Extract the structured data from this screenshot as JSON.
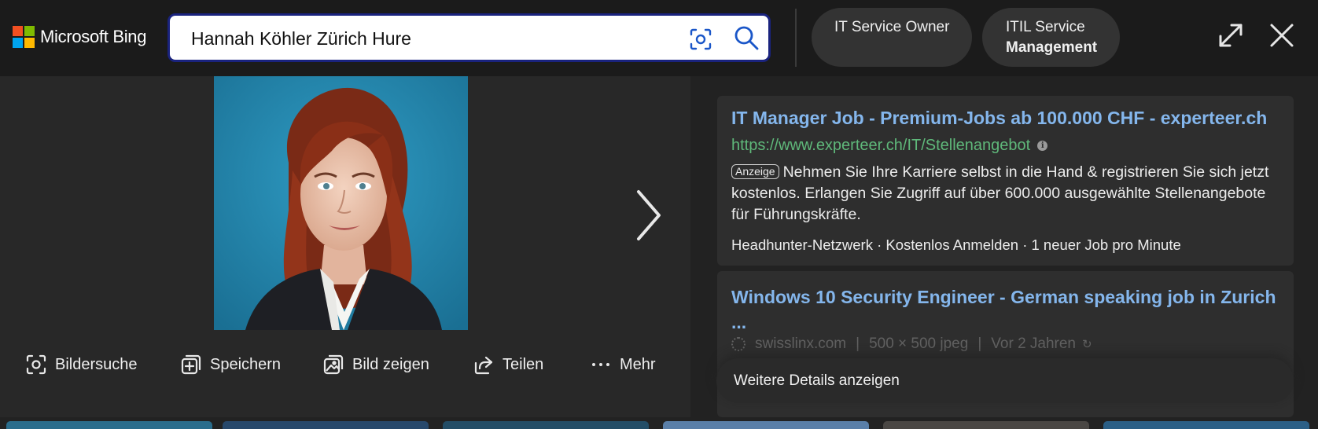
{
  "header": {
    "brand": "Microsoft Bing",
    "search_value": "Hannah Köhler Zürich Hure",
    "search_placeholder": "",
    "icons": [
      "visual-search-icon",
      "search-icon",
      "expand-icon",
      "close-icon"
    ],
    "chips": [
      {
        "label": "IT Service Owner"
      },
      {
        "label_line1": "ITIL Service",
        "label_line2": "Management"
      }
    ]
  },
  "viewer": {
    "image_alt": "Portrait of a woman with red curly hair in a dark blazer on a teal background",
    "actions": [
      {
        "label": "Bildersuche",
        "icon": "visual-search-icon"
      },
      {
        "label": "Speichern",
        "icon": "add-collection-icon"
      },
      {
        "label": "Bild zeigen",
        "icon": "view-image-icon"
      },
      {
        "label": "Teilen",
        "icon": "share-icon"
      },
      {
        "label": "Mehr",
        "icon": "more-icon"
      }
    ]
  },
  "ads": [
    {
      "title": "IT Manager Job - Premium-Jobs ab 100.000 CHF - experteer.ch",
      "url": "https://www.experteer.ch/IT/Stellenangebot",
      "badge": "Anzeige",
      "description": "Nehmen Sie Ihre Karriere selbst in die Hand & registrieren Sie sich jetzt kostenlos. Erlangen Sie Zugriff auf über 600.000 ausgewählte Stellenangebote für Führungskräfte.",
      "sitelinks": "Headhunter-Netzwerk · Kostenlos Anmelden · 1 neuer Job pro Minute"
    }
  ],
  "result": {
    "title": "Windows 10 Security Engineer - German speaking job in Zurich ...",
    "site": "swisslinx.com",
    "size": "500 × 500 jpeg",
    "age": "Vor 2 Jahren"
  },
  "details_button": "Weitere Details anzeigen",
  "colors": {
    "background": "#222222",
    "topbar": "#1b1b1b",
    "link": "#84b6ec",
    "url_green": "#5fb87a",
    "search_border": "#1a237e",
    "photo_bg": "#2489b2"
  }
}
